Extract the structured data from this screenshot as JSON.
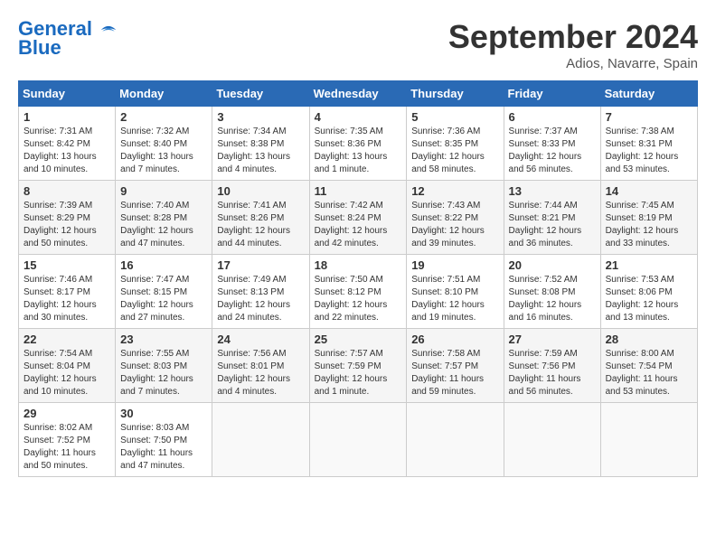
{
  "header": {
    "logo_line1": "General",
    "logo_line2": "Blue",
    "month": "September 2024",
    "location": "Adios, Navarre, Spain"
  },
  "columns": [
    "Sunday",
    "Monday",
    "Tuesday",
    "Wednesday",
    "Thursday",
    "Friday",
    "Saturday"
  ],
  "weeks": [
    [
      {
        "day": "1",
        "detail": "Sunrise: 7:31 AM\nSunset: 8:42 PM\nDaylight: 13 hours\nand 10 minutes."
      },
      {
        "day": "2",
        "detail": "Sunrise: 7:32 AM\nSunset: 8:40 PM\nDaylight: 13 hours\nand 7 minutes."
      },
      {
        "day": "3",
        "detail": "Sunrise: 7:34 AM\nSunset: 8:38 PM\nDaylight: 13 hours\nand 4 minutes."
      },
      {
        "day": "4",
        "detail": "Sunrise: 7:35 AM\nSunset: 8:36 PM\nDaylight: 13 hours\nand 1 minute."
      },
      {
        "day": "5",
        "detail": "Sunrise: 7:36 AM\nSunset: 8:35 PM\nDaylight: 12 hours\nand 58 minutes."
      },
      {
        "day": "6",
        "detail": "Sunrise: 7:37 AM\nSunset: 8:33 PM\nDaylight: 12 hours\nand 56 minutes."
      },
      {
        "day": "7",
        "detail": "Sunrise: 7:38 AM\nSunset: 8:31 PM\nDaylight: 12 hours\nand 53 minutes."
      }
    ],
    [
      {
        "day": "8",
        "detail": "Sunrise: 7:39 AM\nSunset: 8:29 PM\nDaylight: 12 hours\nand 50 minutes."
      },
      {
        "day": "9",
        "detail": "Sunrise: 7:40 AM\nSunset: 8:28 PM\nDaylight: 12 hours\nand 47 minutes."
      },
      {
        "day": "10",
        "detail": "Sunrise: 7:41 AM\nSunset: 8:26 PM\nDaylight: 12 hours\nand 44 minutes."
      },
      {
        "day": "11",
        "detail": "Sunrise: 7:42 AM\nSunset: 8:24 PM\nDaylight: 12 hours\nand 42 minutes."
      },
      {
        "day": "12",
        "detail": "Sunrise: 7:43 AM\nSunset: 8:22 PM\nDaylight: 12 hours\nand 39 minutes."
      },
      {
        "day": "13",
        "detail": "Sunrise: 7:44 AM\nSunset: 8:21 PM\nDaylight: 12 hours\nand 36 minutes."
      },
      {
        "day": "14",
        "detail": "Sunrise: 7:45 AM\nSunset: 8:19 PM\nDaylight: 12 hours\nand 33 minutes."
      }
    ],
    [
      {
        "day": "15",
        "detail": "Sunrise: 7:46 AM\nSunset: 8:17 PM\nDaylight: 12 hours\nand 30 minutes."
      },
      {
        "day": "16",
        "detail": "Sunrise: 7:47 AM\nSunset: 8:15 PM\nDaylight: 12 hours\nand 27 minutes."
      },
      {
        "day": "17",
        "detail": "Sunrise: 7:49 AM\nSunset: 8:13 PM\nDaylight: 12 hours\nand 24 minutes."
      },
      {
        "day": "18",
        "detail": "Sunrise: 7:50 AM\nSunset: 8:12 PM\nDaylight: 12 hours\nand 22 minutes."
      },
      {
        "day": "19",
        "detail": "Sunrise: 7:51 AM\nSunset: 8:10 PM\nDaylight: 12 hours\nand 19 minutes."
      },
      {
        "day": "20",
        "detail": "Sunrise: 7:52 AM\nSunset: 8:08 PM\nDaylight: 12 hours\nand 16 minutes."
      },
      {
        "day": "21",
        "detail": "Sunrise: 7:53 AM\nSunset: 8:06 PM\nDaylight: 12 hours\nand 13 minutes."
      }
    ],
    [
      {
        "day": "22",
        "detail": "Sunrise: 7:54 AM\nSunset: 8:04 PM\nDaylight: 12 hours\nand 10 minutes."
      },
      {
        "day": "23",
        "detail": "Sunrise: 7:55 AM\nSunset: 8:03 PM\nDaylight: 12 hours\nand 7 minutes."
      },
      {
        "day": "24",
        "detail": "Sunrise: 7:56 AM\nSunset: 8:01 PM\nDaylight: 12 hours\nand 4 minutes."
      },
      {
        "day": "25",
        "detail": "Sunrise: 7:57 AM\nSunset: 7:59 PM\nDaylight: 12 hours\nand 1 minute."
      },
      {
        "day": "26",
        "detail": "Sunrise: 7:58 AM\nSunset: 7:57 PM\nDaylight: 11 hours\nand 59 minutes."
      },
      {
        "day": "27",
        "detail": "Sunrise: 7:59 AM\nSunset: 7:56 PM\nDaylight: 11 hours\nand 56 minutes."
      },
      {
        "day": "28",
        "detail": "Sunrise: 8:00 AM\nSunset: 7:54 PM\nDaylight: 11 hours\nand 53 minutes."
      }
    ],
    [
      {
        "day": "29",
        "detail": "Sunrise: 8:02 AM\nSunset: 7:52 PM\nDaylight: 11 hours\nand 50 minutes."
      },
      {
        "day": "30",
        "detail": "Sunrise: 8:03 AM\nSunset: 7:50 PM\nDaylight: 11 hours\nand 47 minutes."
      },
      {
        "day": "",
        "detail": ""
      },
      {
        "day": "",
        "detail": ""
      },
      {
        "day": "",
        "detail": ""
      },
      {
        "day": "",
        "detail": ""
      },
      {
        "day": "",
        "detail": ""
      }
    ]
  ]
}
